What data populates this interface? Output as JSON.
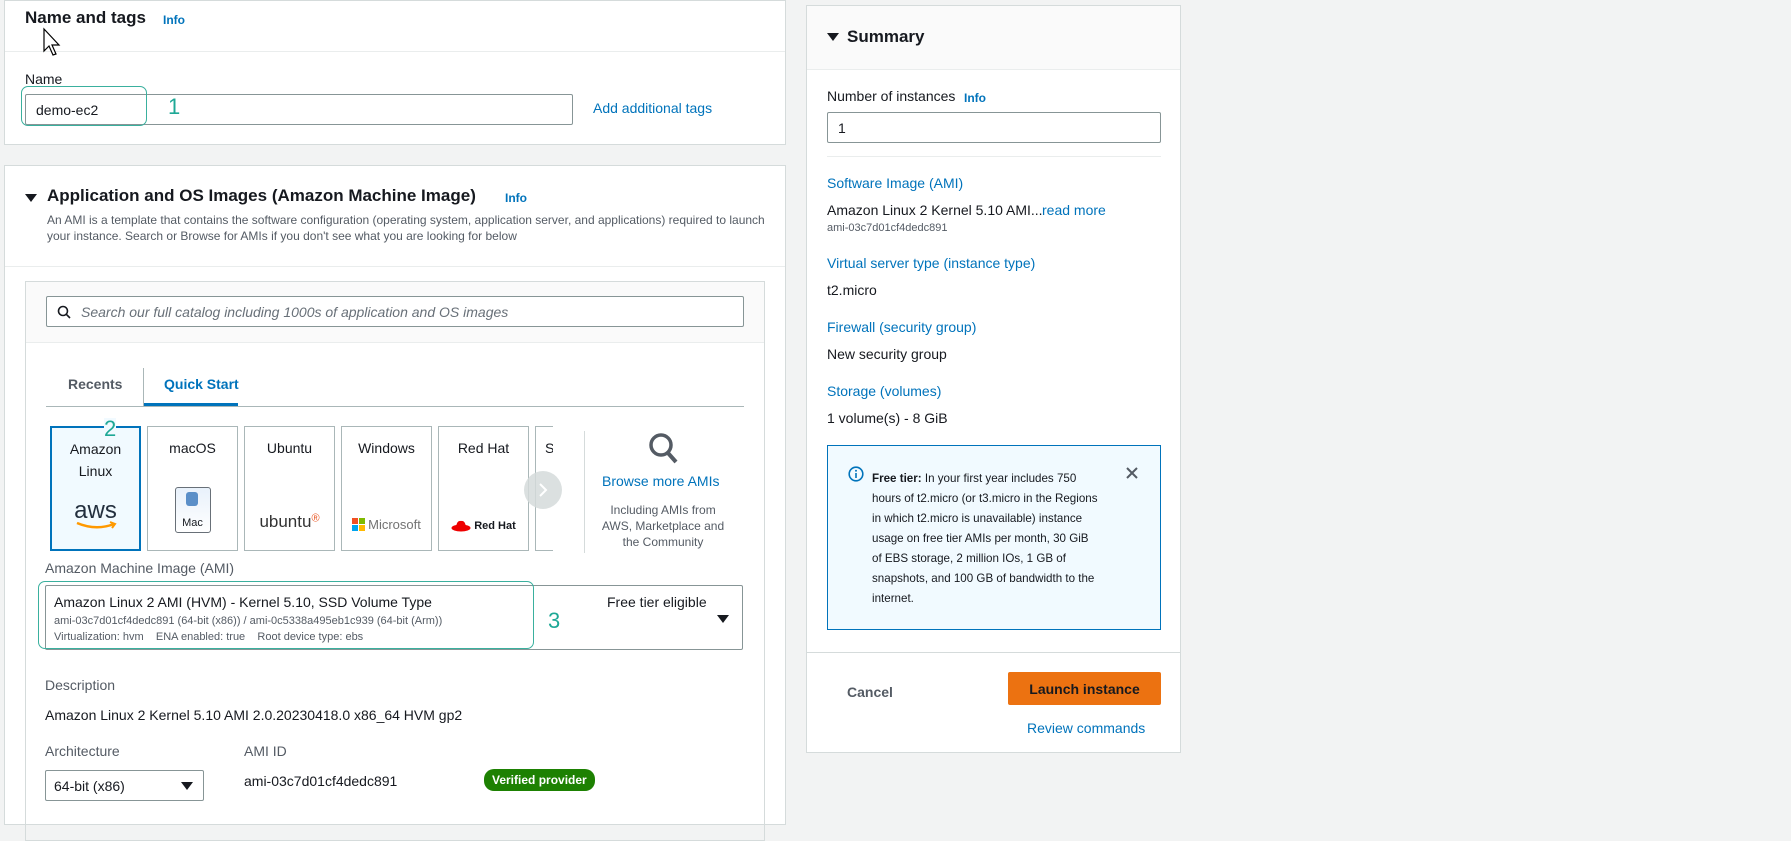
{
  "name_tags": {
    "title": "Name and tags",
    "info": "Info",
    "name_label": "Name",
    "name_value": "demo-ec2",
    "add_tags": "Add additional tags",
    "annotation": "1"
  },
  "ami_section": {
    "title": "Application and OS Images (Amazon Machine Image)",
    "info": "Info",
    "description": "An AMI is a template that contains the software configuration (operating system, application server, and applications) required to launch your instance. Search or Browse for AMIs if you don't see what you are looking for below",
    "search_placeholder": "Search our full catalog including 1000s of application and OS images",
    "tabs": [
      "Recents",
      "Quick Start"
    ],
    "tiles": {
      "amazon": "Amazon Linux",
      "amazon_logo": "aws",
      "macos": "macOS",
      "macos_logo": "Mac",
      "ubuntu": "Ubuntu",
      "ubuntu_logo": "ubuntu",
      "windows": "Windows",
      "windows_logo": "Microsoft",
      "redhat": "Red Hat",
      "redhat_logo": "Red Hat",
      "partial": "S"
    },
    "annotation_2": "2",
    "browse_more": "Browse more AMIs",
    "browse_sub": "Including AMIs from AWS, Marketplace and the Community",
    "ami_label": "Amazon Machine Image (AMI)",
    "ami_name": "Amazon Linux 2 AMI (HVM) - Kernel 5.10, SSD Volume Type",
    "ami_ids": "ami-03c7d01cf4dedc891 (64-bit (x86)) / ami-0c5338a495eb1c939 (64-bit (Arm))",
    "ami_meta": "Virtualization: hvm    ENA enabled: true    Root device type: ebs",
    "free_tier": "Free tier eligible",
    "annotation_3": "3",
    "description_label": "Description",
    "description_value": "Amazon Linux 2 Kernel 5.10 AMI 2.0.20230418.0 x86_64 HVM gp2",
    "arch_label": "Architecture",
    "arch_value": "64-bit (x86)",
    "ami_id_label": "AMI ID",
    "ami_id_value": "ami-03c7d01cf4dedc891",
    "verified": "Verified provider"
  },
  "summary": {
    "title": "Summary",
    "instances_label": "Number of instances",
    "info": "Info",
    "instances_value": "1",
    "software_image_label": "Software Image (AMI)",
    "software_image_value": "Amazon Linux 2 Kernel 5.10 AMI...",
    "read_more": "read more",
    "software_image_id": "ami-03c7d01cf4dedc891",
    "instance_type_label": "Virtual server type (instance type)",
    "instance_type_value": "t2.micro",
    "firewall_label": "Firewall (security group)",
    "firewall_value": "New security group",
    "storage_label": "Storage (volumes)",
    "storage_value": "1 volume(s) - 8 GiB",
    "free_tier_title": "Free tier:",
    "free_tier_text": "In your first year includes 750 hours of t2.micro (or t3.micro in the Regions in which t2.micro is unavailable) instance usage on free tier AMIs per month, 30 GiB of EBS storage, 2 million IOs, 1 GB of snapshots, and 100 GB of bandwidth to the internet.",
    "cancel": "Cancel",
    "launch": "Launch instance",
    "review": "Review commands"
  },
  "colors": {
    "accent_link": "#0073bb",
    "launch_button": "#ec7211",
    "annotation_green": "#1ea896",
    "verified_badge": "#1d8102"
  }
}
